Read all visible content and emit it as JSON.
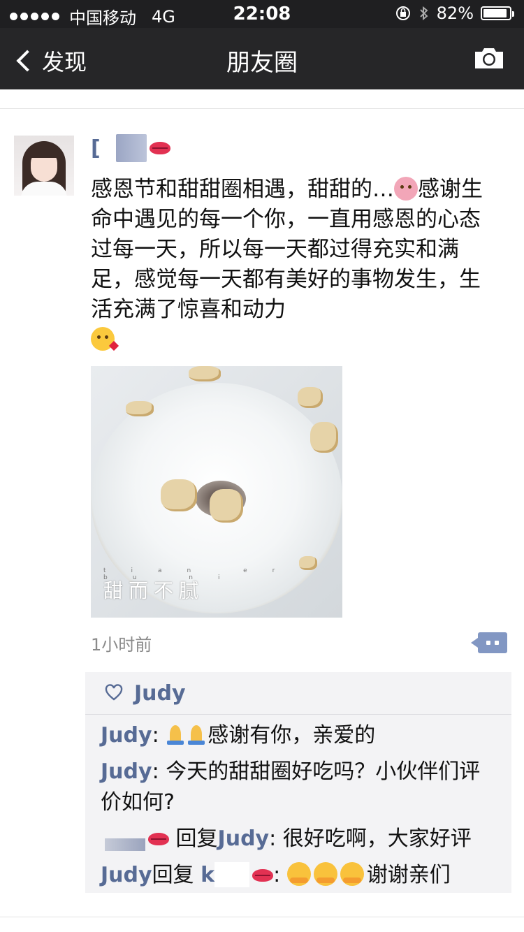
{
  "status_bar": {
    "carrier": "中国移动",
    "network": "4G",
    "time": "22:08",
    "battery": "82%"
  },
  "nav": {
    "back_label": "发现",
    "title": "朋友圈",
    "camera_icon": "camera-icon"
  },
  "post": {
    "username": "[",
    "text_part1": "感恩节和甜甜圈相遇，甜甜的…",
    "text_part2": "感谢生命中遇见的每一个你，一直用感恩的心态过每一天，所以每一天都过得充实和满足，感觉每一天都有美好的事物发生，生活充满了惊喜和动力",
    "photo_caption": "甜而不腻",
    "photo_pinyin": "tian er bu ni",
    "time": "1小时前"
  },
  "likes": {
    "names": "Judy"
  },
  "comments": [
    {
      "name": "Judy",
      "sep": ":",
      "text": "感谢有你，亲爱的"
    },
    {
      "name": "Judy",
      "sep": ":",
      "text": "今天的甜甜圈好吃吗？小伙伴们评价如何?"
    },
    {
      "reply_word": "回复",
      "target": "Judy",
      "sep": ":",
      "text": "很好吃啊，大家好评"
    },
    {
      "name": "Judy",
      "reply_word": "回复",
      "target_visible": "k",
      "sep": ":",
      "text": "谢谢亲们"
    }
  ],
  "colors": {
    "link": "#576b95",
    "nav_bg": "#262628",
    "comment_bg": "#f3f3f5"
  }
}
